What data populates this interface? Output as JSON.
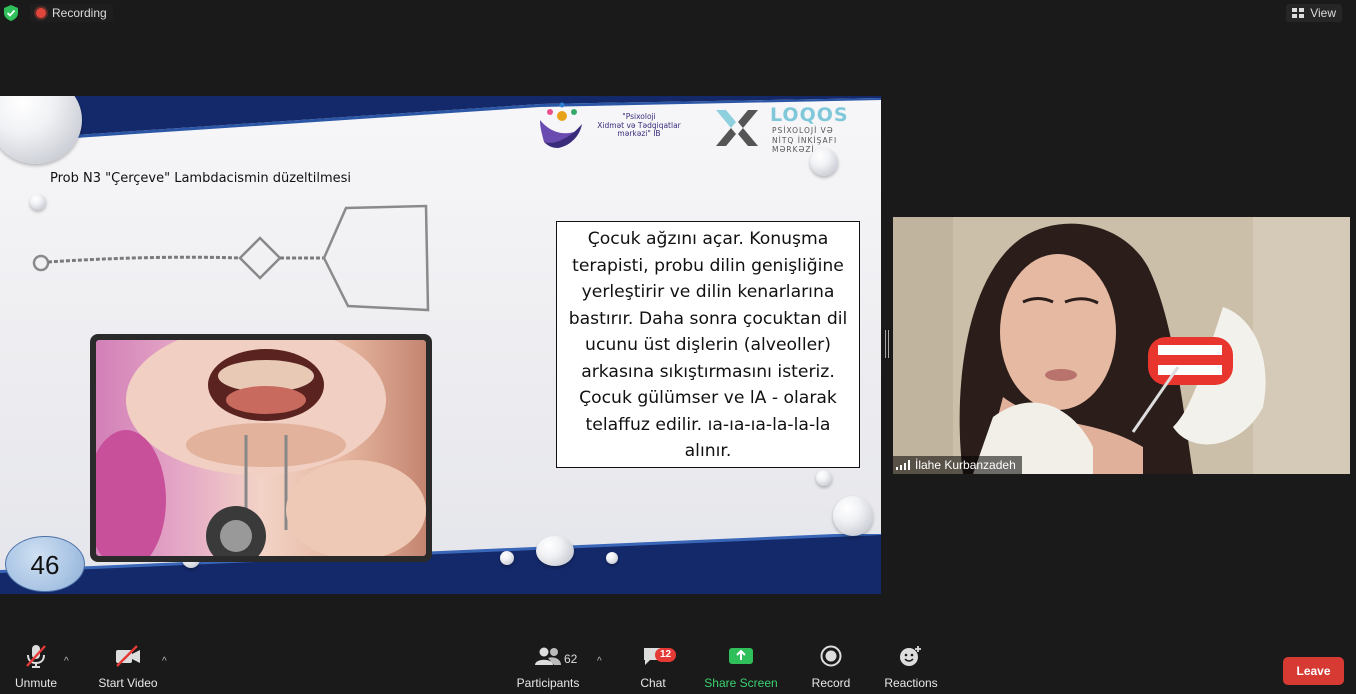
{
  "topbar": {
    "recording_label": "Recording",
    "view_label": "View"
  },
  "slide": {
    "title": "Prob N3 \"Çerçeve\" Lambdacismin düzeltilmesi",
    "logo1_text": [
      "\"Psixoloji",
      "Xidmət və Tədqiqatlar",
      "mərkəzi\" İB"
    ],
    "logo2_name": "LOQOS",
    "logo2_sub": [
      "PSİXOLOJİ VƏ",
      "NİTQ İNKİŞAFI",
      "MƏRKƏZİ"
    ],
    "body_lines": [
      "Çocuk ağzını açar. Konuşma",
      "terapisti, probu dilin genişliğine",
      "yerleştirir ve dilin kenarlarına",
      "bastırır. Daha sonra çocuktan dil",
      "ucunu üst dişlerin (alveoller)",
      "arkasına sıkıştırmasını isteriz.",
      "Çocuk gülümser ve lA - olarak",
      "telaffuz edilir. ıa-ıa-ıa-la-la-la",
      "alınır."
    ],
    "page_number": "46"
  },
  "participant": {
    "name": "İlahe Kurbanzadeh"
  },
  "toolbar": {
    "unmute_label": "Unmute",
    "start_video_label": "Start Video",
    "participants_label": "Participants",
    "participants_count": "62",
    "chat_label": "Chat",
    "chat_badge": "12",
    "share_screen_label": "Share Screen",
    "record_label": "Record",
    "reactions_label": "Reactions",
    "leave_label": "Leave"
  },
  "colors": {
    "slide_band": "#14296a",
    "share_green": "#3bd16f",
    "leave_red": "#d63a33",
    "recording_red": "#e0463a"
  }
}
